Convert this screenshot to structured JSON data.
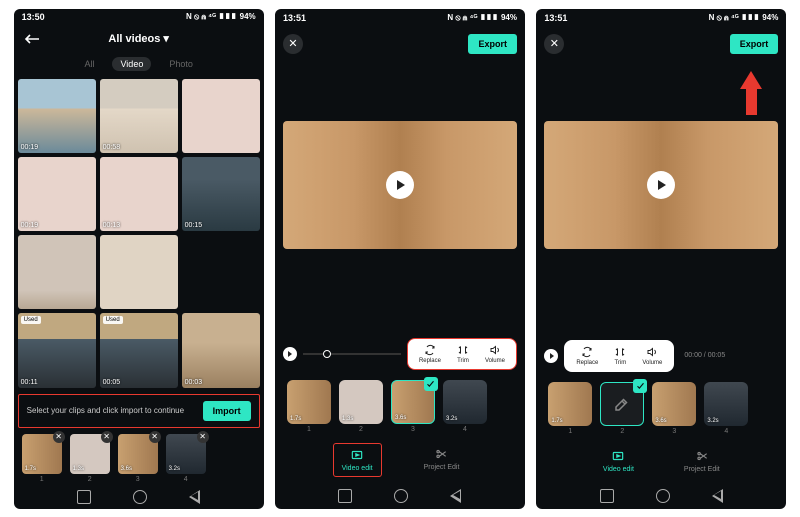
{
  "status": {
    "time1": "13:50",
    "time2": "13:51",
    "battery": "94%",
    "icons": "N ⦸ ⋒ ⁴ᴳ ▮▮▮"
  },
  "screen1": {
    "title": "All videos",
    "tabs": {
      "all": "All",
      "video": "Video",
      "photo": "Photo"
    },
    "thumbs": [
      {
        "dur": "00:19"
      },
      {
        "dur": "00:58"
      },
      {
        "dur": ""
      },
      {
        "dur": "00:19"
      },
      {
        "dur": "00:13"
      },
      {
        "dur": "00:15"
      },
      {
        "dur": ""
      },
      {
        "dur": ""
      },
      {
        "dur": ""
      },
      {
        "dur": "00:11",
        "used": "Used"
      },
      {
        "dur": "00:05",
        "used": "Used"
      },
      {
        "dur": "00:03"
      }
    ],
    "import_text": "Select your clips and click import to continue",
    "import_label": "Import",
    "clips": [
      {
        "dur": "1.7s",
        "num": "1"
      },
      {
        "dur": "1.3s",
        "num": "2"
      },
      {
        "dur": "3.6s",
        "num": "3"
      },
      {
        "dur": "3.2s",
        "num": "4"
      }
    ]
  },
  "screen2": {
    "export_label": "Export",
    "tools": {
      "replace": "Replace",
      "trim": "Trim",
      "volume": "Volume"
    },
    "time_counter": "00:00 / 00:05",
    "clips": [
      {
        "dur": "1.7s",
        "num": "1"
      },
      {
        "dur": "1.3s",
        "num": "2"
      },
      {
        "dur": "3.6s",
        "num": "3"
      },
      {
        "dur": "3.2s",
        "num": "4"
      }
    ],
    "bottom_tabs": {
      "video_edit": "Video edit",
      "project_edit": "Project Edit"
    }
  }
}
